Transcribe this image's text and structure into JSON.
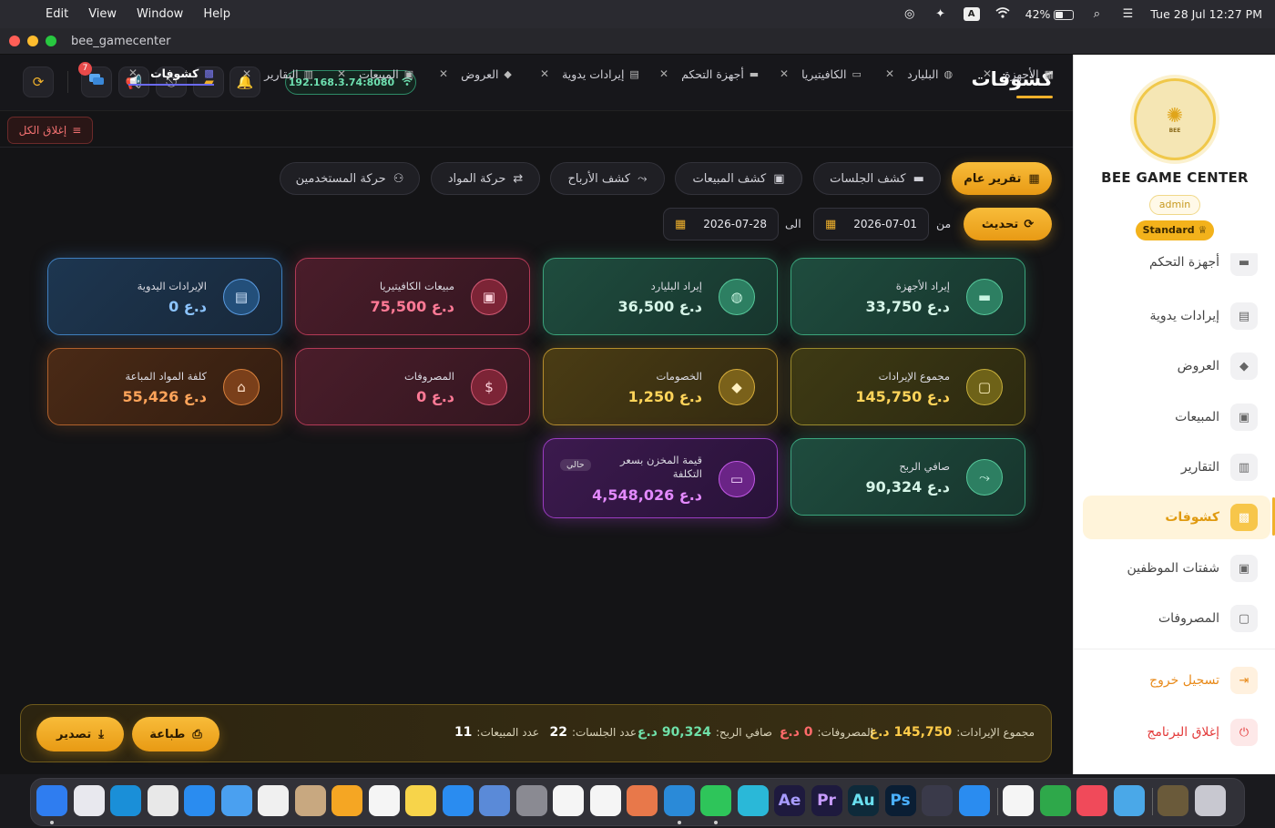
{
  "menubar": {
    "apple": "",
    "app_name": "bee_gamecenter",
    "items": [
      "Edit",
      "View",
      "Window",
      "Help"
    ],
    "status": {
      "keyboard": "A",
      "battery": "42%",
      "datetime": "Tue 28 Jul  12:27 PM"
    }
  },
  "window": {
    "title": "bee_gamecenter"
  },
  "header": {
    "title": "كشوفات",
    "ip": "192.168.3.74:8080",
    "messages_badge": "7"
  },
  "tabs": [
    {
      "label": "الأجهزة",
      "icon": "grid-icon"
    },
    {
      "label": "البليارد",
      "icon": "billiard-icon"
    },
    {
      "label": "الكافيتيريا",
      "icon": "cafe-icon"
    },
    {
      "label": "أجهزة التحكم",
      "icon": "gamepad-icon"
    },
    {
      "label": "إيرادات يدوية",
      "icon": "card-icon"
    },
    {
      "label": "العروض",
      "icon": "tag-icon"
    },
    {
      "label": "المبيعات",
      "icon": "register-icon"
    },
    {
      "label": "التقارير",
      "icon": "report-icon"
    },
    {
      "label": "كشوفات",
      "icon": "statement-icon"
    }
  ],
  "close_all": "إغلاق الكل",
  "report_buttons": [
    {
      "label": "تقرير عام",
      "icon": "dashboard-icon"
    },
    {
      "label": "كشف الجلسات",
      "icon": "gamepad-icon"
    },
    {
      "label": "كشف المبيعات",
      "icon": "register-icon"
    },
    {
      "label": "كشف الأرباح",
      "icon": "trend-icon"
    },
    {
      "label": "حركة المواد",
      "icon": "swap-icon"
    },
    {
      "label": "حركة المستخدمين",
      "icon": "users-icon"
    }
  ],
  "filters": {
    "refresh": "تحديث",
    "from_label": "من",
    "to_label": "الى",
    "from_date": "2026-07-01",
    "to_date": "2026-07-28"
  },
  "cards": [
    {
      "label": "إيراد الأجهزة",
      "value": "33,750 د.ع",
      "icon": "gamepad-icon"
    },
    {
      "label": "إيراد البليارد",
      "value": "36,500 د.ع",
      "icon": "billiard-icon"
    },
    {
      "label": "مبيعات الكافيتيريا",
      "value": "75,500 د.ع",
      "icon": "register-icon"
    },
    {
      "label": "الإيرادات اليدوية",
      "value": "0 د.ع",
      "icon": "card-icon"
    },
    {
      "label": "مجموع الإيرادات",
      "value": "145,750 د.ع",
      "icon": "wallet-icon"
    },
    {
      "label": "الخصومات",
      "value": "1,250 د.ع",
      "icon": "tag-icon"
    },
    {
      "label": "المصروفات",
      "value": "0 د.ع",
      "icon": "dollar-icon"
    },
    {
      "label": "كلفة المواد المباعة",
      "value": "55,426 د.ع",
      "icon": "basket-icon"
    },
    {
      "label": "صافي الربح",
      "value": "90,324 د.ع",
      "icon": "trend-icon"
    },
    {
      "label": "قيمة المخزن بسعر التكلفة",
      "value": "4,548,026 د.ع",
      "icon": "box-icon",
      "tag": "حالي"
    }
  ],
  "summary": {
    "total_revenue_label": "مجموع الإيرادات:",
    "total_revenue": "145,750 د.ع",
    "expenses_label": "المصروفات:",
    "expenses": "0 د.ع",
    "net_profit_label": "صافي الربح:",
    "net_profit": "90,324 د.ع",
    "sessions_label": "عدد الجلسات:",
    "sessions": "22",
    "sales_label": "عدد المبيعات:",
    "sales": "11",
    "print": "طباعة",
    "export": "تصدير"
  },
  "sidebar": {
    "brand": "BEE GAME CENTER",
    "logo_text": "BEE",
    "role": "admin",
    "plan": "Standard",
    "items": [
      {
        "label": "أجهزة التحكم",
        "icon": "gamepad-icon"
      },
      {
        "label": "إيرادات يدوية",
        "icon": "card-icon"
      },
      {
        "label": "العروض",
        "icon": "tag-icon"
      },
      {
        "label": "المبيعات",
        "icon": "register-icon"
      },
      {
        "label": "التقارير",
        "icon": "report-icon"
      },
      {
        "label": "كشوفات",
        "icon": "statement-icon"
      },
      {
        "label": "شفتات الموظفين",
        "icon": "badge-icon"
      },
      {
        "label": "المصروفات",
        "icon": "wallet-icon"
      }
    ],
    "logout": "تسجيل خروج",
    "quit": "إغلاق البرنامج"
  },
  "dock": [
    {
      "name": "Finder",
      "color": "#2f7df0"
    },
    {
      "name": "Launchpad",
      "color": "#e8e8ee"
    },
    {
      "name": "Edge",
      "color": "#1a8fd8"
    },
    {
      "name": "Chrome",
      "color": "#e8e8e8"
    },
    {
      "name": "Safari",
      "color": "#2a8cf0"
    },
    {
      "name": "Mail",
      "color": "#4aa0f0"
    },
    {
      "name": "Photos",
      "color": "#f0f0f0"
    },
    {
      "name": "Contacts",
      "color": "#c8a880"
    },
    {
      "name": "Pages",
      "color": "#f5a623"
    },
    {
      "name": "Reminders",
      "color": "#f5f5f5"
    },
    {
      "name": "Notes",
      "color": "#f7d44a"
    },
    {
      "name": "App Store",
      "color": "#2a8cf0"
    },
    {
      "name": "Simulator",
      "color": "#5a8ad8"
    },
    {
      "name": "Settings",
      "color": "#8a8a92"
    },
    {
      "name": "ChatGPT",
      "color": "#f5f5f5"
    },
    {
      "name": "Gemini",
      "color": "#f5f5f5"
    },
    {
      "name": "Claude",
      "color": "#e8784a"
    },
    {
      "name": "VS Code",
      "color": "#2a8ad8"
    },
    {
      "name": "WhatsApp",
      "color": "#2ec55a"
    },
    {
      "name": "Canva",
      "color": "#2ab8d8"
    },
    {
      "name": "Ae",
      "color": "#1e1a3e"
    },
    {
      "name": "Pr",
      "color": "#1e1a3e"
    },
    {
      "name": "Au",
      "color": "#0e2a3a"
    },
    {
      "name": "Ps",
      "color": "#0a1e34"
    },
    {
      "name": "DaVinci",
      "color": "#3a3a4a"
    },
    {
      "name": "QuickTime",
      "color": "#2a8cf0"
    },
    {
      "name": "Sheets",
      "color": "#f5f5f5"
    },
    {
      "name": "Numbers",
      "color": "#2ea84a"
    },
    {
      "name": "Music",
      "color": "#f04a5a"
    },
    {
      "name": "Flutter",
      "color": "#4aa8e8"
    },
    {
      "name": "Downloads",
      "color": "#6a5a3a"
    },
    {
      "name": "Trash",
      "color": "#c8c8d0"
    }
  ]
}
